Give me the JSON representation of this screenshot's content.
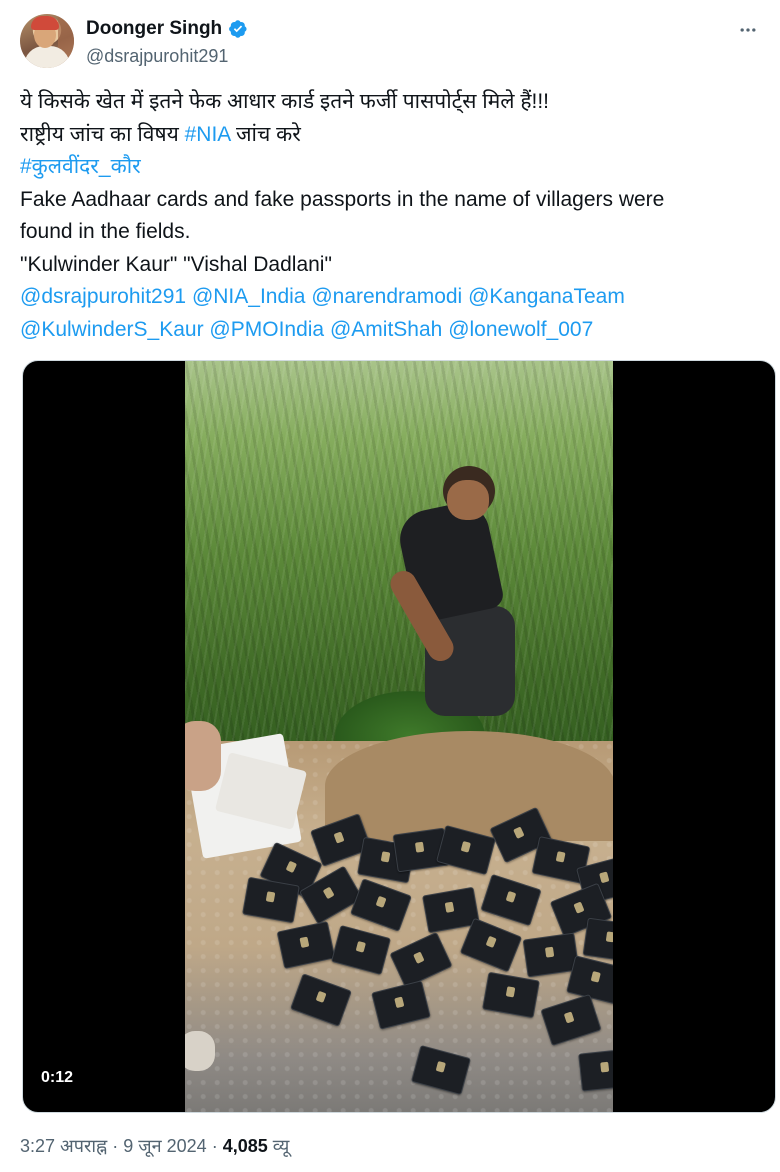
{
  "author": {
    "name": "Doonger Singh",
    "handle": "@dsrajpurohit291",
    "verified": true,
    "verified_color": "#1d9bf0"
  },
  "tweet": {
    "lines": [
      {
        "parts": [
          {
            "text": "ये किसके खेत में इतने फेक आधार कार्ड इतने फर्जी पासपोर्ट्स मिले हैं!!!",
            "link": false
          }
        ]
      },
      {
        "parts": [
          {
            "text": "राष्ट्रीय जांच का विषय ",
            "link": false
          },
          {
            "text": "#NIA",
            "link": true
          },
          {
            "text": " जांच करे",
            "link": false
          }
        ]
      },
      {
        "parts": [
          {
            "text": "#कुलवींदर_कौर",
            "link": true
          }
        ]
      },
      {
        "parts": [
          {
            "text": "Fake Aadhaar cards and fake passports in the name of villagers were",
            "link": false
          }
        ]
      },
      {
        "parts": [
          {
            "text": "found in the fields.",
            "link": false
          }
        ]
      },
      {
        "parts": [
          {
            "text": "\"Kulwinder Kaur\"  \"Vishal Dadlani\"",
            "link": false
          }
        ]
      },
      {
        "parts": [
          {
            "text": "@dsrajpurohit291",
            "link": true
          },
          {
            "text": " ",
            "link": false
          },
          {
            "text": "@NIA_India",
            "link": true
          },
          {
            "text": " ",
            "link": false
          },
          {
            "text": "@narendramodi",
            "link": true
          },
          {
            "text": " ",
            "link": false
          },
          {
            "text": "@KanganaTeam",
            "link": true
          }
        ]
      },
      {
        "parts": [
          {
            "text": "@KulwinderS_Kaur",
            "link": true
          },
          {
            "text": " ",
            "link": false
          },
          {
            "text": "@PMOIndia",
            "link": true
          },
          {
            "text": " ",
            "link": false
          },
          {
            "text": "@AmitShah",
            "link": true
          },
          {
            "text": " ",
            "link": false
          },
          {
            "text": "@lonewolf_007",
            "link": true
          }
        ]
      }
    ],
    "link_color": "#1d9bf0"
  },
  "media": {
    "type": "video",
    "duration": "0:12"
  },
  "meta": {
    "time": "3:27 अपराह्न",
    "separator": "·",
    "date": "9 जून 2024",
    "views_count": "4,085",
    "views_label": "व्यू"
  },
  "icons": {
    "verified": "verified-badge-icon",
    "more": "more-options-icon"
  }
}
